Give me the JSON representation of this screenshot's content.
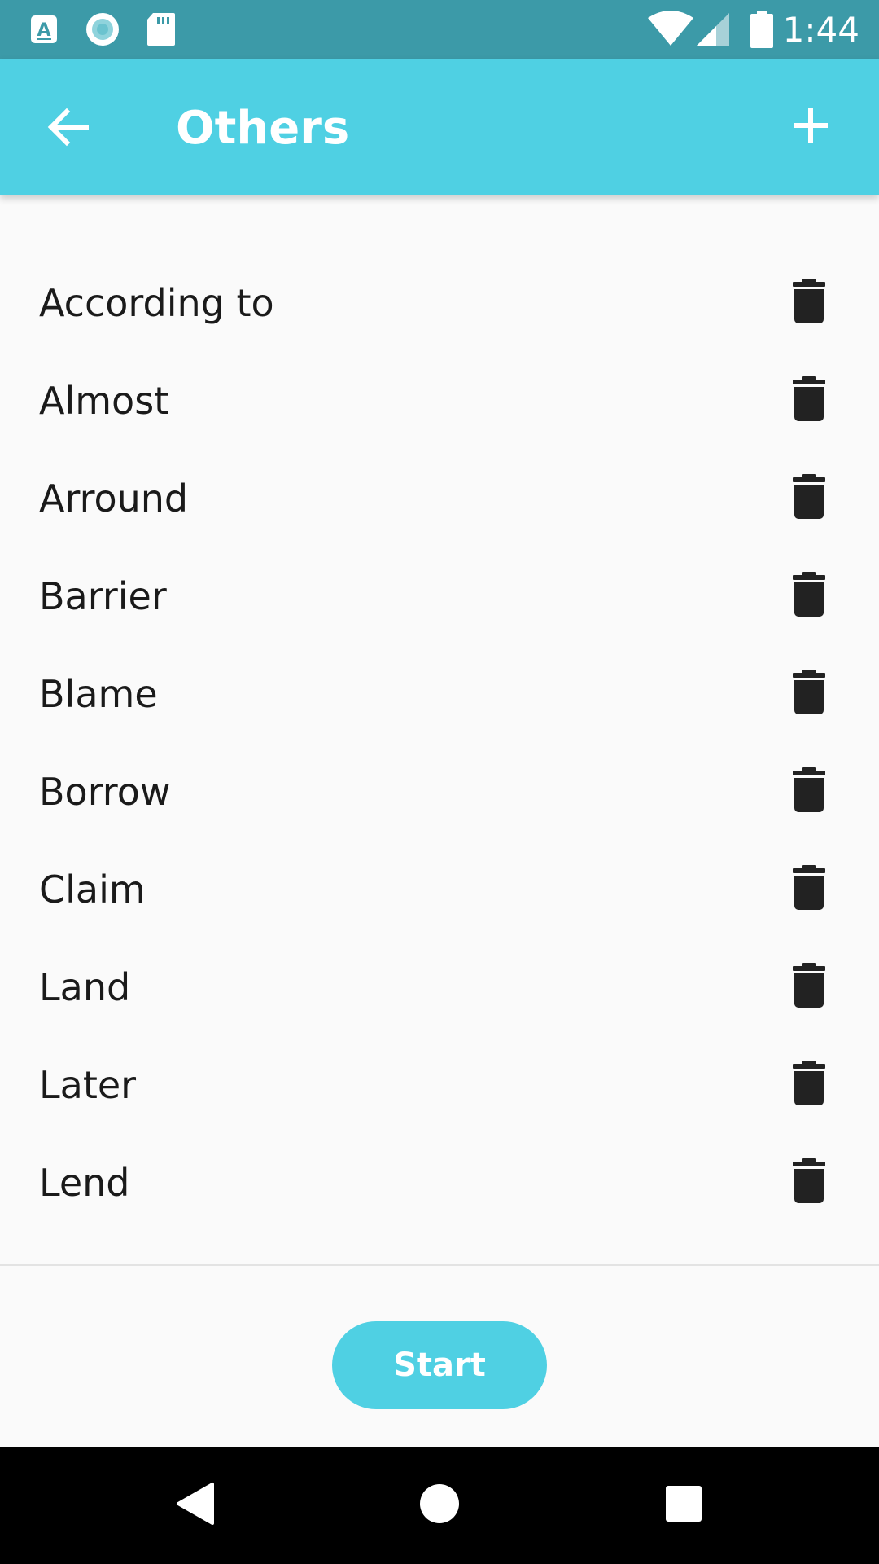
{
  "status_bar": {
    "time": "1:44",
    "left_icons": [
      "text-a-icon",
      "circle-record-icon",
      "sd-card-icon"
    ],
    "right_icons": [
      "wifi-icon",
      "cell-signal-icon",
      "battery-icon"
    ]
  },
  "app_bar": {
    "title": "Others",
    "back_icon": "arrow-left-icon",
    "add_icon": "plus-icon",
    "color": "#4fd0e3"
  },
  "words": [
    {
      "label": "According to"
    },
    {
      "label": "Almost"
    },
    {
      "label": "Arround"
    },
    {
      "label": "Barrier"
    },
    {
      "label": "Blame"
    },
    {
      "label": "Borrow"
    },
    {
      "label": "Claim"
    },
    {
      "label": "Land"
    },
    {
      "label": "Later"
    },
    {
      "label": "Lend"
    }
  ],
  "row_action_icon": "trash-icon",
  "start_button": {
    "label": "Start"
  },
  "nav_bar": {
    "icons": [
      "nav-back-icon",
      "nav-home-icon",
      "nav-recents-icon"
    ]
  }
}
